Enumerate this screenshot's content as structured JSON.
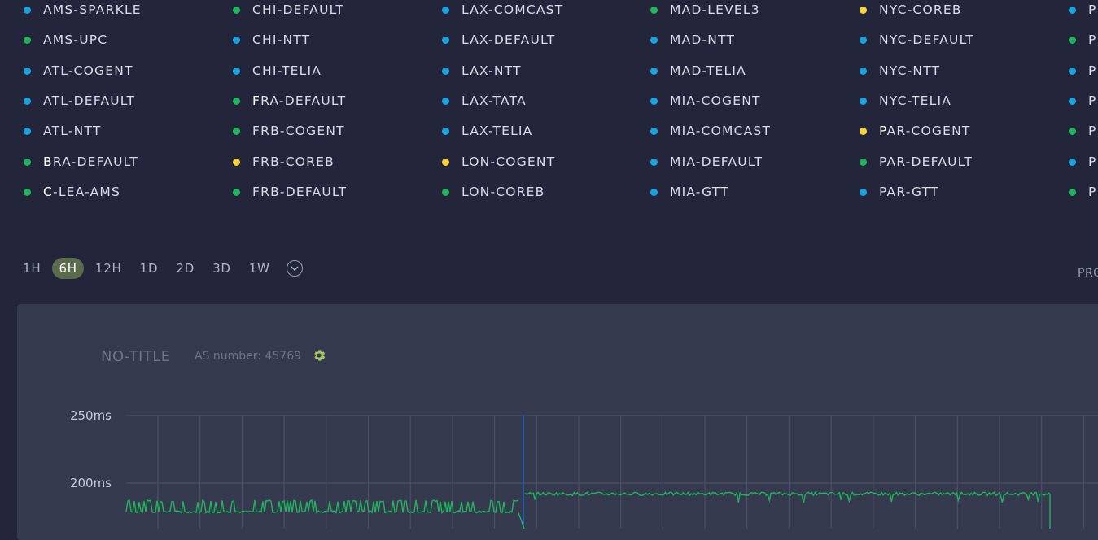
{
  "colors": {
    "blue": "#1ba3e0",
    "green": "#22b35e",
    "yellow": "#f7d33a",
    "series_line": "#22b35e",
    "marker_line": "#2a5db0",
    "active_range": "#5c6a4e"
  },
  "legend": {
    "columns": [
      {
        "items": [
          {
            "first": "",
            "rest": "AMS-SPARKLE",
            "color": "blue"
          },
          {
            "first": "",
            "rest": "AMS-UPC",
            "color": "green"
          },
          {
            "first": "",
            "rest": "ATL-COGENT",
            "color": "blue"
          },
          {
            "first": "",
            "rest": "ATL-DEFAULT",
            "color": "blue"
          },
          {
            "first": "",
            "rest": "ATL-NTT",
            "color": "blue"
          },
          {
            "first": "B",
            "rest": "RA-DEFAULT",
            "color": "green"
          },
          {
            "first": "C",
            "rest": "-LEA-AMS",
            "color": "green"
          }
        ]
      },
      {
        "items": [
          {
            "first": "",
            "rest": "CHI-DEFAULT",
            "color": "green"
          },
          {
            "first": "",
            "rest": "CHI-NTT",
            "color": "blue"
          },
          {
            "first": "",
            "rest": "CHI-TELIA",
            "color": "blue"
          },
          {
            "first": "F",
            "rest": "RA-DEFAULT",
            "color": "green"
          },
          {
            "first": "",
            "rest": "FRB-COGENT",
            "color": "green"
          },
          {
            "first": "",
            "rest": "FRB-COREB",
            "color": "yellow"
          },
          {
            "first": "",
            "rest": "FRB-DEFAULT",
            "color": "green"
          }
        ]
      },
      {
        "items": [
          {
            "first": "",
            "rest": "LAX-COMCAST",
            "color": "blue"
          },
          {
            "first": "",
            "rest": "LAX-DEFAULT",
            "color": "blue"
          },
          {
            "first": "",
            "rest": "LAX-NTT",
            "color": "blue"
          },
          {
            "first": "",
            "rest": "LAX-TATA",
            "color": "blue"
          },
          {
            "first": "",
            "rest": "LAX-TELIA",
            "color": "blue"
          },
          {
            "first": "",
            "rest": "LON-COGENT",
            "color": "yellow"
          },
          {
            "first": "",
            "rest": "LON-COREB",
            "color": "green"
          }
        ]
      },
      {
        "items": [
          {
            "first": "",
            "rest": "MAD-LEVEL3",
            "color": "green"
          },
          {
            "first": "",
            "rest": "MAD-NTT",
            "color": "blue"
          },
          {
            "first": "",
            "rest": "MAD-TELIA",
            "color": "blue"
          },
          {
            "first": "",
            "rest": "MIA-COGENT",
            "color": "blue"
          },
          {
            "first": "",
            "rest": "MIA-COMCAST",
            "color": "blue"
          },
          {
            "first": "",
            "rest": "MIA-DEFAULT",
            "color": "blue"
          },
          {
            "first": "",
            "rest": "MIA-GTT",
            "color": "blue"
          }
        ]
      },
      {
        "items": [
          {
            "first": "",
            "rest": "NYC-COREB",
            "color": "yellow"
          },
          {
            "first": "",
            "rest": "NYC-DEFAULT",
            "color": "blue"
          },
          {
            "first": "",
            "rest": "NYC-NTT",
            "color": "blue"
          },
          {
            "first": "",
            "rest": "NYC-TELIA",
            "color": "blue"
          },
          {
            "first": "P",
            "rest": "AR-COGENT",
            "color": "yellow"
          },
          {
            "first": "",
            "rest": "PAR-DEFAULT",
            "color": "green"
          },
          {
            "first": "",
            "rest": "PAR-GTT",
            "color": "blue"
          }
        ]
      },
      {
        "items": [
          {
            "first": "",
            "rest": "P",
            "color": "blue"
          },
          {
            "first": "",
            "rest": "P",
            "color": "green"
          },
          {
            "first": "",
            "rest": "P",
            "color": "blue"
          },
          {
            "first": "",
            "rest": "P",
            "color": "blue"
          },
          {
            "first": "",
            "rest": "P",
            "color": "green"
          },
          {
            "first": "",
            "rest": "P",
            "color": "blue"
          },
          {
            "first": "",
            "rest": "P",
            "color": "green"
          }
        ]
      }
    ]
  },
  "time_range": {
    "options": [
      "1H",
      "6H",
      "12H",
      "1D",
      "2D",
      "3D",
      "1W"
    ],
    "active": "6H",
    "more_icon": "chevron-down-circle-icon",
    "right_label": "PRO"
  },
  "panel": {
    "title": "NO-TITLE",
    "as_label": "AS number: 45769",
    "settings_icon": "gear-icon"
  },
  "chart_data": {
    "type": "line",
    "y_ticks": [
      "250ms",
      "200ms"
    ],
    "y_tick_values": [
      250,
      200
    ],
    "ylim": [
      160,
      265
    ],
    "grid": true,
    "series": [
      {
        "color": "green",
        "segments": [
          {
            "x_range": [
              0.0,
              0.425
            ],
            "baseline": 178,
            "spike_top": 186,
            "pattern": "spiky"
          },
          {
            "x_range": [
              0.432,
              1.0
            ],
            "baseline": 192,
            "spike_top": 195,
            "pattern": "noisy"
          }
        ]
      }
    ],
    "marker_at_fraction": 0.43
  }
}
